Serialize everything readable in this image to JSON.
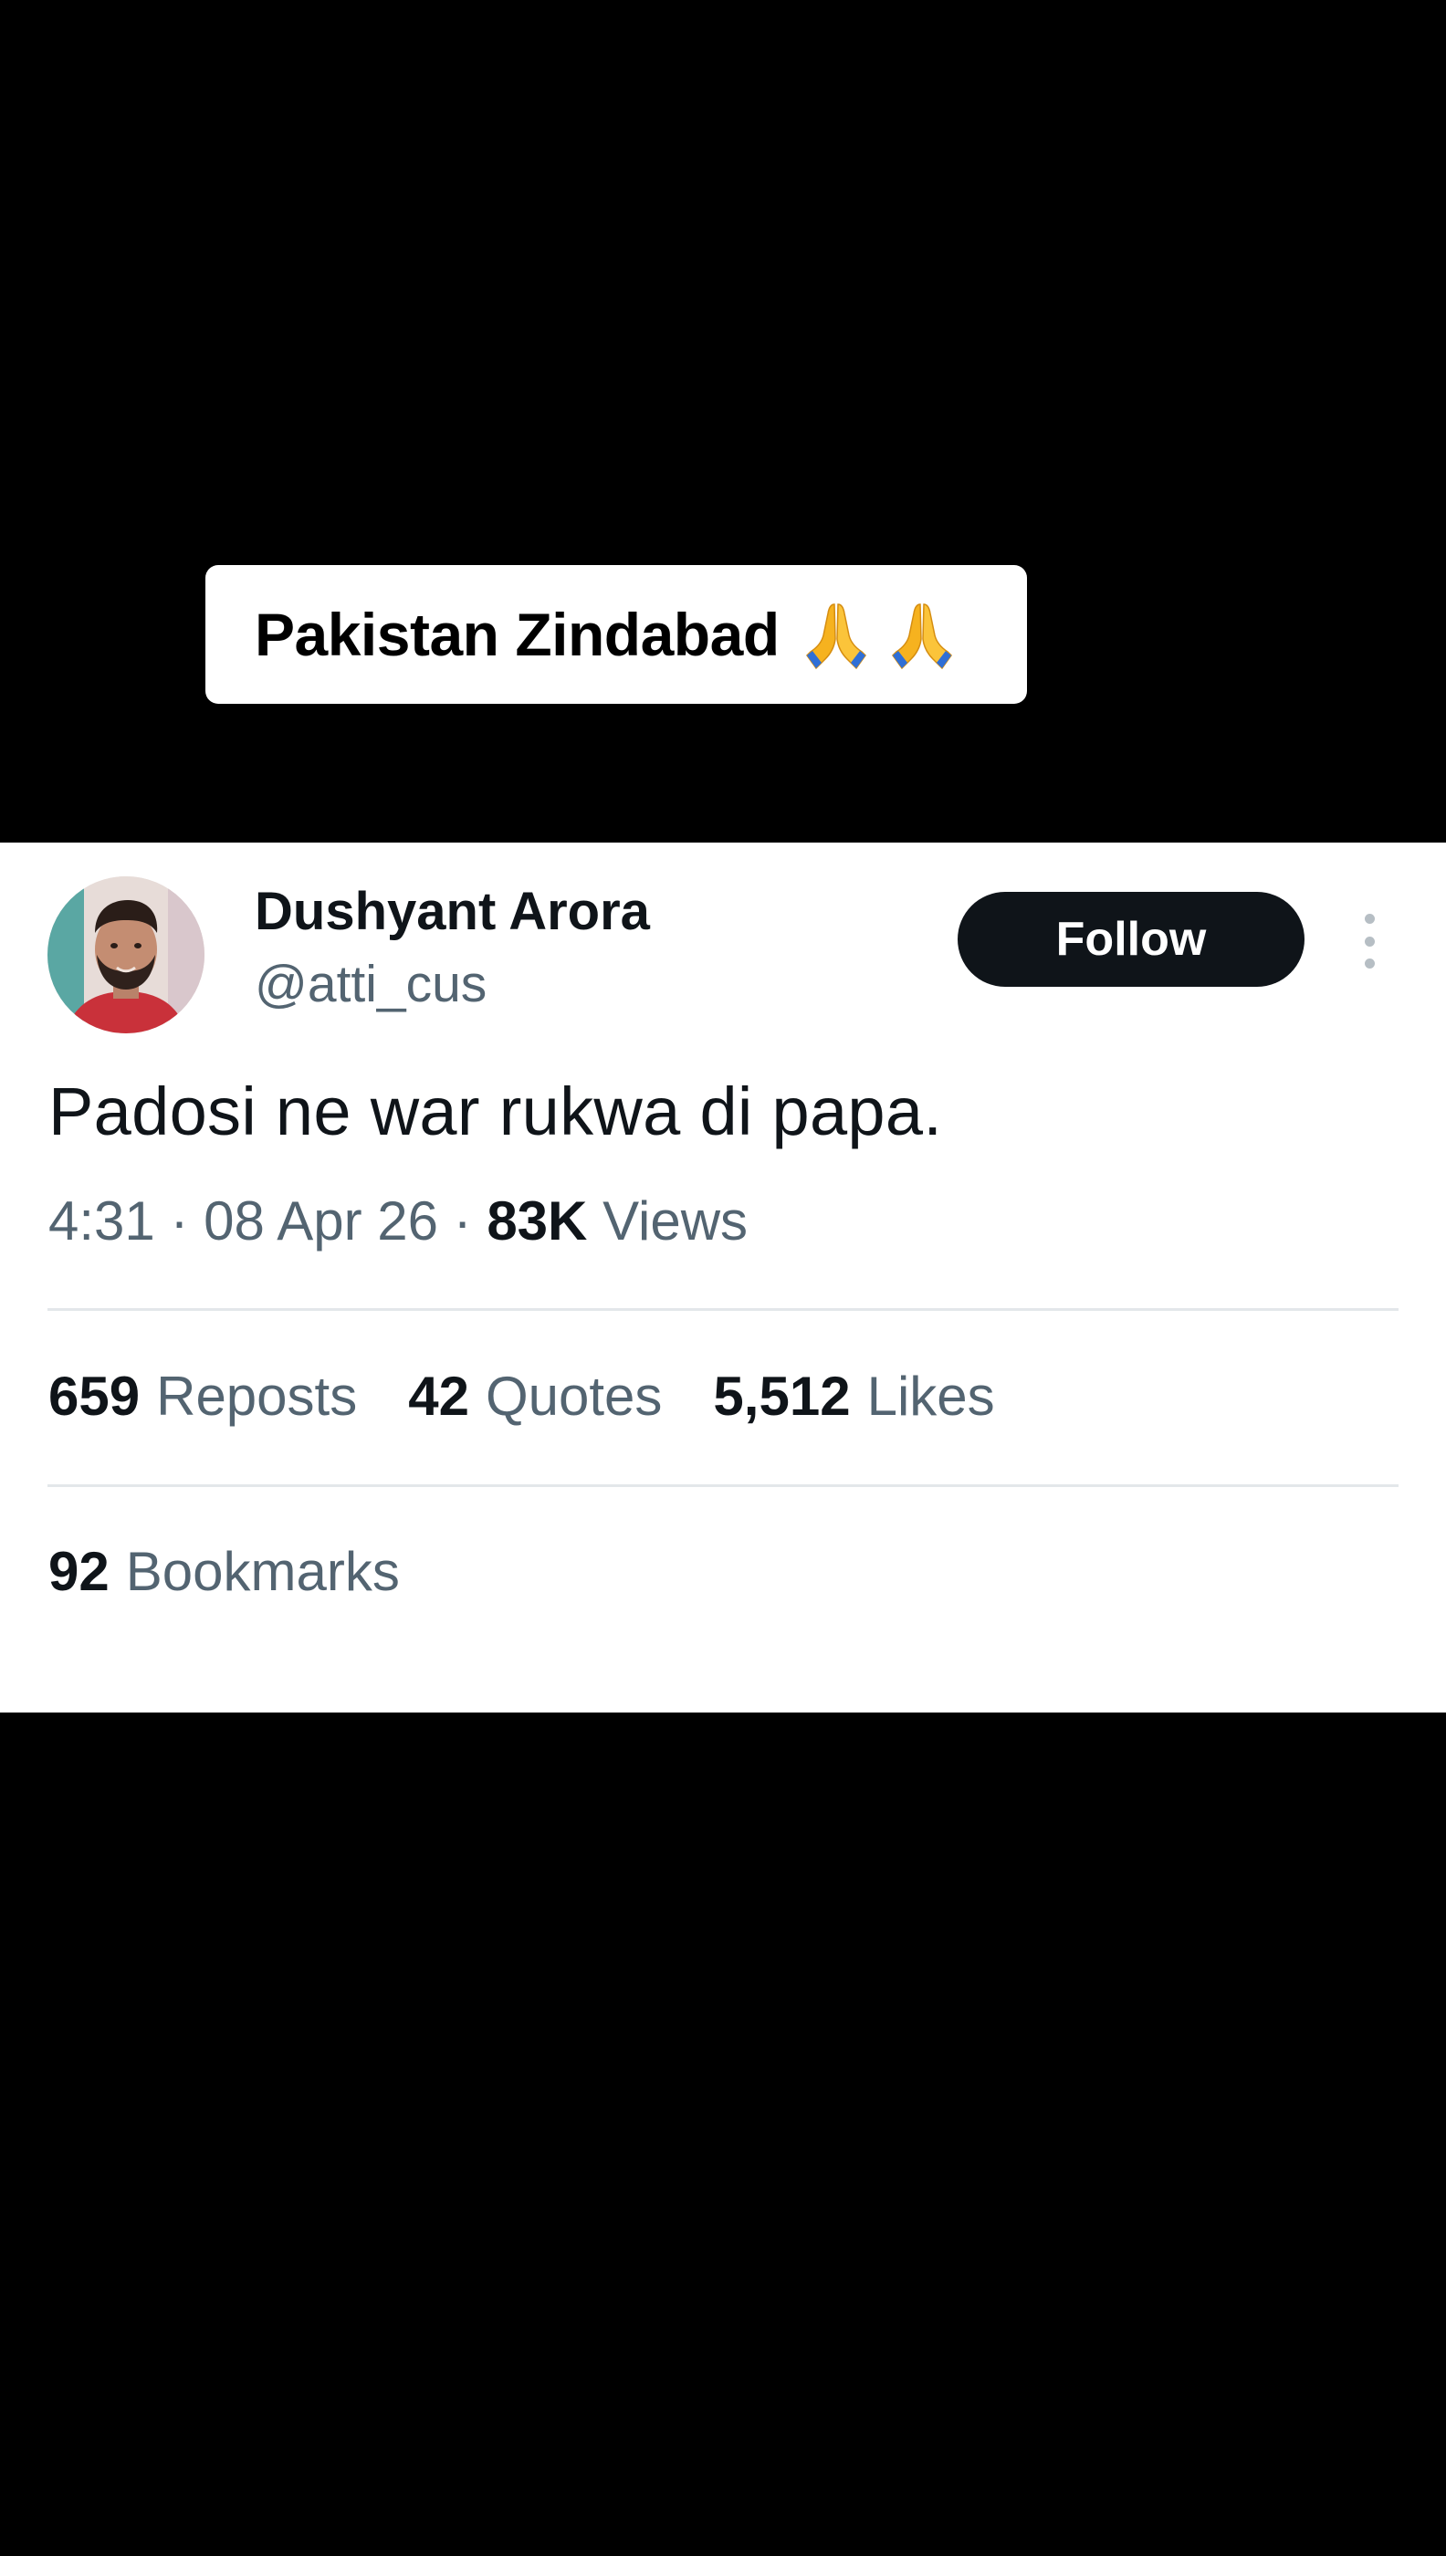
{
  "caption": {
    "text": "Pakistan Zindabad",
    "emojis": [
      "folded-hands",
      "folded-hands"
    ]
  },
  "tweet": {
    "author": {
      "name": "Dushyant Arora",
      "handle": "@atti_cus"
    },
    "follow_label": "Follow",
    "more_icon": "more-vertical-icon",
    "text": "Padosi ne war rukwa di papa.",
    "time": "4:31",
    "date": "08 Apr 26",
    "separator": "·",
    "views_count": "83K",
    "views_label": "Views",
    "stats": {
      "reposts_count": "659",
      "reposts_label": "Reposts",
      "quotes_count": "42",
      "quotes_label": "Quotes",
      "likes_count": "5,512",
      "likes_label": "Likes"
    },
    "bookmarks_count": "92",
    "bookmarks_label": "Bookmarks"
  },
  "colors": {
    "page_background": "#000000",
    "card_background": "#ffffff",
    "primary_text": "#0f1419",
    "secondary_text": "#536471",
    "follow_button": "#0f1419",
    "divider": "#e3e7ea"
  }
}
